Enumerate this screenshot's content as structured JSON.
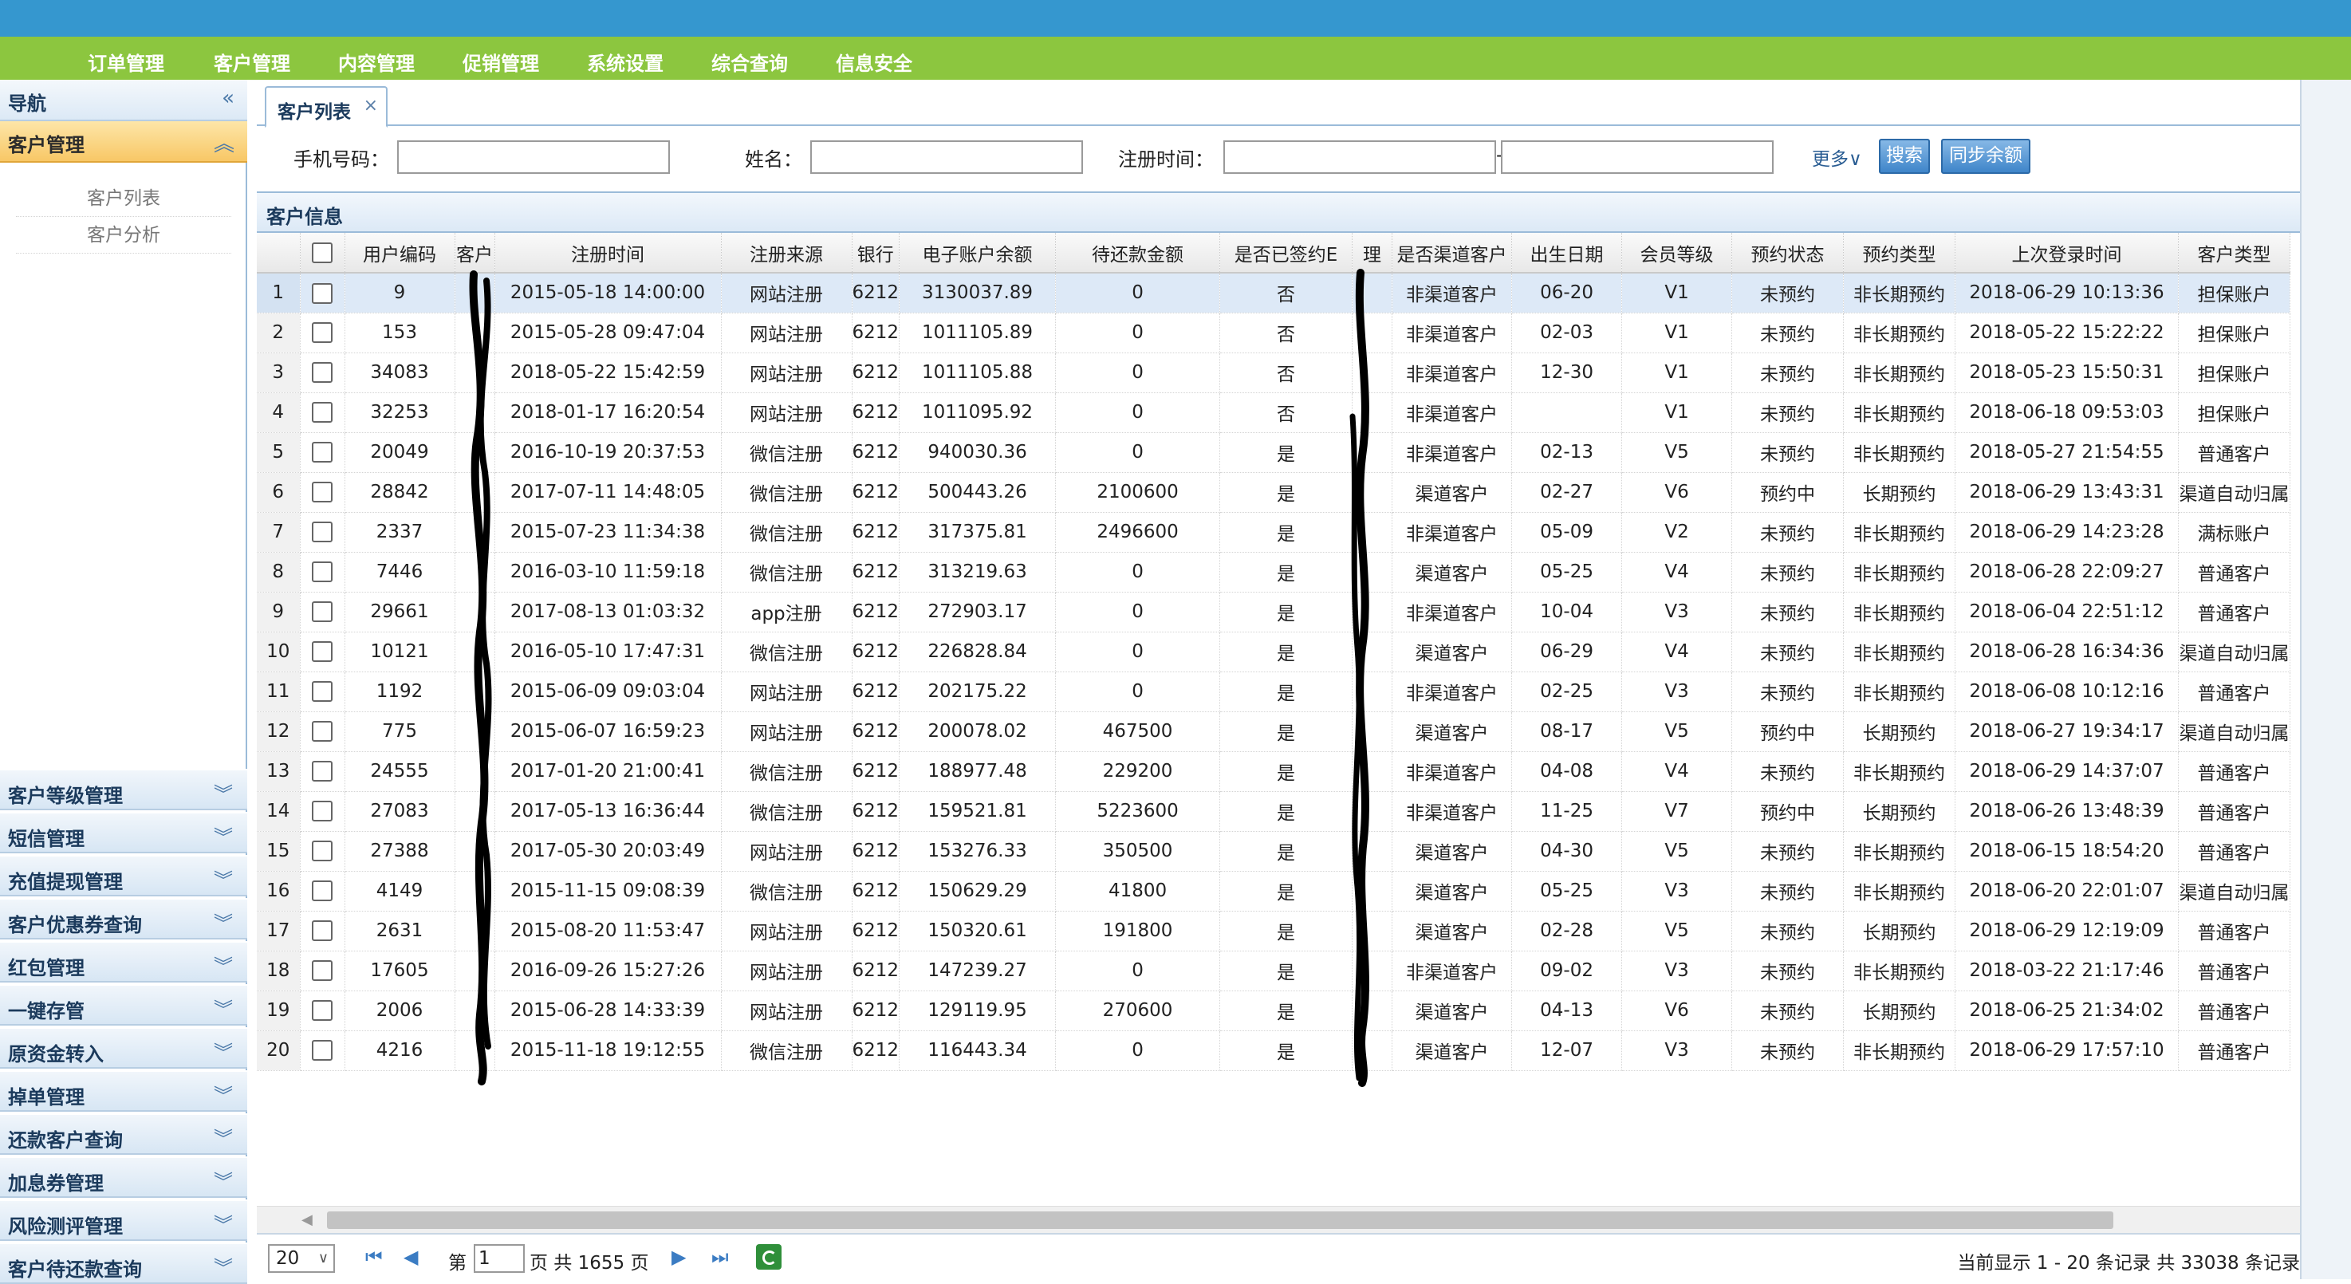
{
  "top_menu": [
    "订单管理",
    "客户管理",
    "内容管理",
    "促销管理",
    "系统设置",
    "综合查询",
    "信息安全"
  ],
  "sidebar": {
    "nav_title": "导航",
    "nav_collapse_glyph": "«",
    "active_section": "客户管理",
    "active_section_glyph": "︽",
    "sub_items": [
      "客户列表",
      "客户分析"
    ],
    "sections": [
      "客户等级管理",
      "短信管理",
      "充值提现管理",
      "客户优惠券查询",
      "红包管理",
      "一键存管",
      "原资金转入",
      "掉单管理",
      "还款客户查询",
      "加息券管理",
      "风险测评管理",
      "客户待还款查询"
    ],
    "section_glyph": "︾"
  },
  "tab": {
    "label": "客户列表",
    "close": "×"
  },
  "search": {
    "phone_label": "手机号码：",
    "name_label": "姓名：",
    "regtime_label": "注册时间：",
    "range_sep": "-",
    "more_label": "更多∨",
    "search_button": "搜索",
    "sync_button": "同步余额"
  },
  "panel_title": "客户信息",
  "table": {
    "columns": [
      "用户编码",
      "客户",
      "注册时间",
      "注册来源",
      "银行",
      "电子账户余额",
      "待还款金额",
      "是否已签约E",
      "理",
      "是否渠道客户",
      "出生日期",
      "会员等级",
      "预约状态",
      "预约类型",
      "上次登录时间",
      "客户类型"
    ],
    "rows": [
      {
        "n": "1",
        "id": "9",
        "name": "",
        "reg": "2015-05-18 14:00:00",
        "src": "网站注册",
        "bank": "6212",
        "bal": "3130037.89",
        "due": "0",
        "signed": "否",
        "mgr": "",
        "channel": "非渠道客户",
        "birth": "06-20",
        "level": "V1",
        "rstat": "未预约",
        "rtype": "非长期预约",
        "login": "2018-06-29 10:13:36",
        "ctype": "担保账户"
      },
      {
        "n": "2",
        "id": "153",
        "name": "",
        "reg": "2015-05-28 09:47:04",
        "src": "网站注册",
        "bank": "6212",
        "bal": "1011105.89",
        "due": "0",
        "signed": "否",
        "mgr": "",
        "channel": "非渠道客户",
        "birth": "02-03",
        "level": "V1",
        "rstat": "未预约",
        "rtype": "非长期预约",
        "login": "2018-05-22 15:22:22",
        "ctype": "担保账户"
      },
      {
        "n": "3",
        "id": "34083",
        "name": "",
        "reg": "2018-05-22 15:42:59",
        "src": "网站注册",
        "bank": "6212",
        "bal": "1011105.88",
        "due": "0",
        "signed": "否",
        "mgr": "",
        "channel": "非渠道客户",
        "birth": "12-30",
        "level": "V1",
        "rstat": "未预约",
        "rtype": "非长期预约",
        "login": "2018-05-23 15:50:31",
        "ctype": "担保账户"
      },
      {
        "n": "4",
        "id": "32253",
        "name": "",
        "reg": "2018-01-17 16:20:54",
        "src": "网站注册",
        "bank": "6212",
        "bal": "1011095.92",
        "due": "0",
        "signed": "否",
        "mgr": "",
        "channel": "非渠道客户",
        "birth": "",
        "level": "V1",
        "rstat": "未预约",
        "rtype": "非长期预约",
        "login": "2018-06-18 09:53:03",
        "ctype": "担保账户"
      },
      {
        "n": "5",
        "id": "20049",
        "name": "",
        "reg": "2016-10-19 20:37:53",
        "src": "微信注册",
        "bank": "6212",
        "bal": "940030.36",
        "due": "0",
        "signed": "是",
        "mgr": "",
        "channel": "非渠道客户",
        "birth": "02-13",
        "level": "V5",
        "rstat": "未预约",
        "rtype": "非长期预约",
        "login": "2018-05-27 21:54:55",
        "ctype": "普通客户"
      },
      {
        "n": "6",
        "id": "28842",
        "name": "",
        "reg": "2017-07-11 14:48:05",
        "src": "微信注册",
        "bank": "6212",
        "bal": "500443.26",
        "due": "2100600",
        "signed": "是",
        "mgr": "",
        "channel": "渠道客户",
        "birth": "02-27",
        "level": "V6",
        "rstat": "预约中",
        "rtype": "长期预约",
        "login": "2018-06-29 13:43:31",
        "ctype": "渠道自动归属"
      },
      {
        "n": "7",
        "id": "2337",
        "name": "",
        "reg": "2015-07-23 11:34:38",
        "src": "微信注册",
        "bank": "6212",
        "bal": "317375.81",
        "due": "2496600",
        "signed": "是",
        "mgr": "",
        "channel": "非渠道客户",
        "birth": "05-09",
        "level": "V2",
        "rstat": "未预约",
        "rtype": "非长期预约",
        "login": "2018-06-29 14:23:28",
        "ctype": "满标账户"
      },
      {
        "n": "8",
        "id": "7446",
        "name": "",
        "reg": "2016-03-10 11:59:18",
        "src": "微信注册",
        "bank": "6212",
        "bal": "313219.63",
        "due": "0",
        "signed": "是",
        "mgr": "",
        "channel": "渠道客户",
        "birth": "05-25",
        "level": "V4",
        "rstat": "未预约",
        "rtype": "非长期预约",
        "login": "2018-06-28 22:09:27",
        "ctype": "普通客户"
      },
      {
        "n": "9",
        "id": "29661",
        "name": "",
        "reg": "2017-08-13 01:03:32",
        "src": "app注册",
        "bank": "6212",
        "bal": "272903.17",
        "due": "0",
        "signed": "是",
        "mgr": "",
        "channel": "非渠道客户",
        "birth": "10-04",
        "level": "V3",
        "rstat": "未预约",
        "rtype": "非长期预约",
        "login": "2018-06-04 22:51:12",
        "ctype": "普通客户"
      },
      {
        "n": "10",
        "id": "10121",
        "name": "",
        "reg": "2016-05-10 17:47:31",
        "src": "微信注册",
        "bank": "6212",
        "bal": "226828.84",
        "due": "0",
        "signed": "是",
        "mgr": "",
        "channel": "渠道客户",
        "birth": "06-29",
        "level": "V4",
        "rstat": "未预约",
        "rtype": "非长期预约",
        "login": "2018-06-28 16:34:36",
        "ctype": "渠道自动归属"
      },
      {
        "n": "11",
        "id": "1192",
        "name": "",
        "reg": "2015-06-09 09:03:04",
        "src": "网站注册",
        "bank": "6212",
        "bal": "202175.22",
        "due": "0",
        "signed": "是",
        "mgr": "",
        "channel": "非渠道客户",
        "birth": "02-25",
        "level": "V3",
        "rstat": "未预约",
        "rtype": "非长期预约",
        "login": "2018-06-08 10:12:16",
        "ctype": "普通客户"
      },
      {
        "n": "12",
        "id": "775",
        "name": "",
        "reg": "2015-06-07 16:59:23",
        "src": "网站注册",
        "bank": "6212",
        "bal": "200078.02",
        "due": "467500",
        "signed": "是",
        "mgr": "",
        "channel": "渠道客户",
        "birth": "08-17",
        "level": "V5",
        "rstat": "预约中",
        "rtype": "长期预约",
        "login": "2018-06-27 19:34:17",
        "ctype": "渠道自动归属"
      },
      {
        "n": "13",
        "id": "24555",
        "name": "",
        "reg": "2017-01-20 21:00:41",
        "src": "微信注册",
        "bank": "6212",
        "bal": "188977.48",
        "due": "229200",
        "signed": "是",
        "mgr": "",
        "channel": "非渠道客户",
        "birth": "04-08",
        "level": "V4",
        "rstat": "未预约",
        "rtype": "非长期预约",
        "login": "2018-06-29 14:37:07",
        "ctype": "普通客户"
      },
      {
        "n": "14",
        "id": "27083",
        "name": "",
        "reg": "2017-05-13 16:36:44",
        "src": "微信注册",
        "bank": "6212",
        "bal": "159521.81",
        "due": "5223600",
        "signed": "是",
        "mgr": "",
        "channel": "非渠道客户",
        "birth": "11-25",
        "level": "V7",
        "rstat": "预约中",
        "rtype": "长期预约",
        "login": "2018-06-26 13:48:39",
        "ctype": "普通客户"
      },
      {
        "n": "15",
        "id": "27388",
        "name": "",
        "reg": "2017-05-30 20:03:49",
        "src": "网站注册",
        "bank": "6212",
        "bal": "153276.33",
        "due": "350500",
        "signed": "是",
        "mgr": "",
        "channel": "渠道客户",
        "birth": "04-30",
        "level": "V5",
        "rstat": "未预约",
        "rtype": "非长期预约",
        "login": "2018-06-15 18:54:20",
        "ctype": "普通客户"
      },
      {
        "n": "16",
        "id": "4149",
        "name": "",
        "reg": "2015-11-15 09:08:39",
        "src": "微信注册",
        "bank": "6212",
        "bal": "150629.29",
        "due": "41800",
        "signed": "是",
        "mgr": "",
        "channel": "渠道客户",
        "birth": "05-25",
        "level": "V3",
        "rstat": "未预约",
        "rtype": "非长期预约",
        "login": "2018-06-20 22:01:07",
        "ctype": "渠道自动归属"
      },
      {
        "n": "17",
        "id": "2631",
        "name": "",
        "reg": "2015-08-20 11:53:47",
        "src": "网站注册",
        "bank": "6212",
        "bal": "150320.61",
        "due": "191800",
        "signed": "是",
        "mgr": "",
        "channel": "渠道客户",
        "birth": "02-28",
        "level": "V5",
        "rstat": "未预约",
        "rtype": "长期预约",
        "login": "2018-06-29 12:19:09",
        "ctype": "普通客户"
      },
      {
        "n": "18",
        "id": "17605",
        "name": "",
        "reg": "2016-09-26 15:27:26",
        "src": "网站注册",
        "bank": "6212",
        "bal": "147239.27",
        "due": "0",
        "signed": "是",
        "mgr": "",
        "channel": "非渠道客户",
        "birth": "09-02",
        "level": "V3",
        "rstat": "未预约",
        "rtype": "非长期预约",
        "login": "2018-03-22 21:17:46",
        "ctype": "普通客户"
      },
      {
        "n": "19",
        "id": "2006",
        "name": "",
        "reg": "2015-06-28 14:33:39",
        "src": "网站注册",
        "bank": "6212",
        "bal": "129119.95",
        "due": "270600",
        "signed": "是",
        "mgr": "",
        "channel": "渠道客户",
        "birth": "04-13",
        "level": "V6",
        "rstat": "未预约",
        "rtype": "长期预约",
        "login": "2018-06-25 21:34:02",
        "ctype": "普通客户"
      },
      {
        "n": "20",
        "id": "4216",
        "name": "",
        "reg": "2015-11-18 19:12:55",
        "src": "微信注册",
        "bank": "6212",
        "bal": "116443.34",
        "due": "0",
        "signed": "是",
        "mgr": "",
        "channel": "渠道客户",
        "birth": "12-07",
        "level": "V3",
        "rstat": "未预约",
        "rtype": "非长期预约",
        "login": "2018-06-29 17:57:10",
        "ctype": "普通客户"
      }
    ]
  },
  "pager": {
    "page_size": "20",
    "page_size_glyph": "∨",
    "first_glyph": "⏮",
    "prev_glyph": "◀",
    "next_glyph": "▶",
    "last_glyph": "⏭",
    "page_prefix": "第",
    "page_value": "1",
    "page_suffix": "页 共 1655 页",
    "summary": "当前显示 1 - 20 条记录 共 33038 条记录"
  },
  "colors": {
    "top_bar": "#3597cf",
    "menu_bar": "#8cc63f",
    "active_section": "#f8c766",
    "selected_row": "#dde9f7",
    "redaction": "#000000"
  }
}
